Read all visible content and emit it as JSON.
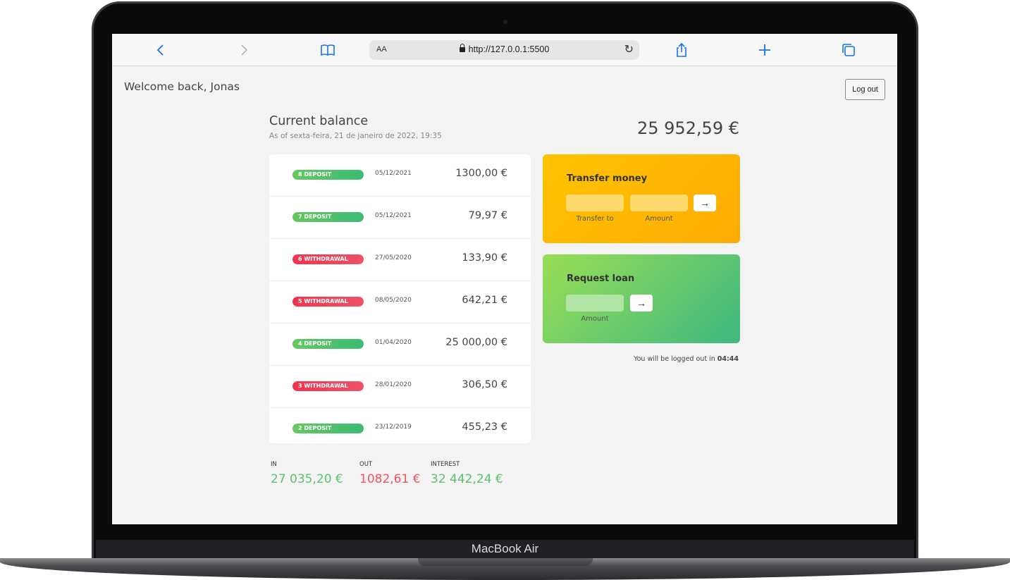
{
  "device": {
    "brand": "MacBook Air"
  },
  "browser": {
    "back_icon": "chevron-left-icon",
    "forward_icon": "chevron-right-icon",
    "bookmarks_icon": "book-icon",
    "text_size": "AA",
    "url": "http://127.0.0.1:5500",
    "reload_icon": "reload-icon",
    "share_icon": "share-icon",
    "new_tab_icon": "plus-icon",
    "tabs_icon": "tabs-icon"
  },
  "header": {
    "welcome": "Welcome back, Jonas",
    "logout_label": "Log out"
  },
  "balance": {
    "title": "Current balance",
    "date": "As of sexta-feira, 21 de janeiro de 2022, 19:35",
    "value": "25 952,59 €"
  },
  "movements": [
    {
      "type": "deposit",
      "label": "8 DEPOSIT",
      "date": "05/12/2021",
      "amount": "1300,00 €"
    },
    {
      "type": "deposit",
      "label": "7 DEPOSIT",
      "date": "05/12/2021",
      "amount": "79,97 €"
    },
    {
      "type": "withdrawal",
      "label": "6 WITHDRAWAL",
      "date": "27/05/2020",
      "amount": "133,90 €"
    },
    {
      "type": "withdrawal",
      "label": "5 WITHDRAWAL",
      "date": "08/05/2020",
      "amount": "642,21 €"
    },
    {
      "type": "deposit",
      "label": "4 DEPOSIT",
      "date": "01/04/2020",
      "amount": "25 000,00 €"
    },
    {
      "type": "withdrawal",
      "label": "3 WITHDRAWAL",
      "date": "28/01/2020",
      "amount": "306,50 €"
    },
    {
      "type": "deposit",
      "label": "2 DEPOSIT",
      "date": "23/12/2019",
      "amount": "455,23 €"
    }
  ],
  "summary": {
    "in_label": "IN",
    "in_value": "27 035,20 €",
    "out_label": "OUT",
    "out_value": "1082,61 €",
    "interest_label": "INTEREST",
    "interest_value": "32 442,24 €"
  },
  "transfer": {
    "title": "Transfer money",
    "to_label": "Transfer to",
    "amount_label": "Amount",
    "button": "→"
  },
  "loan": {
    "title": "Request loan",
    "amount_label": "Amount",
    "button": "→"
  },
  "timer": {
    "text": "You will be logged out in ",
    "time": "04:44"
  },
  "colors": {
    "deposit": "#66c75e",
    "withdrawal": "#f0344e",
    "transfer_bg": "#ffc300",
    "loan_bg": "#99de55",
    "browser_accent": "#1a73e8"
  }
}
